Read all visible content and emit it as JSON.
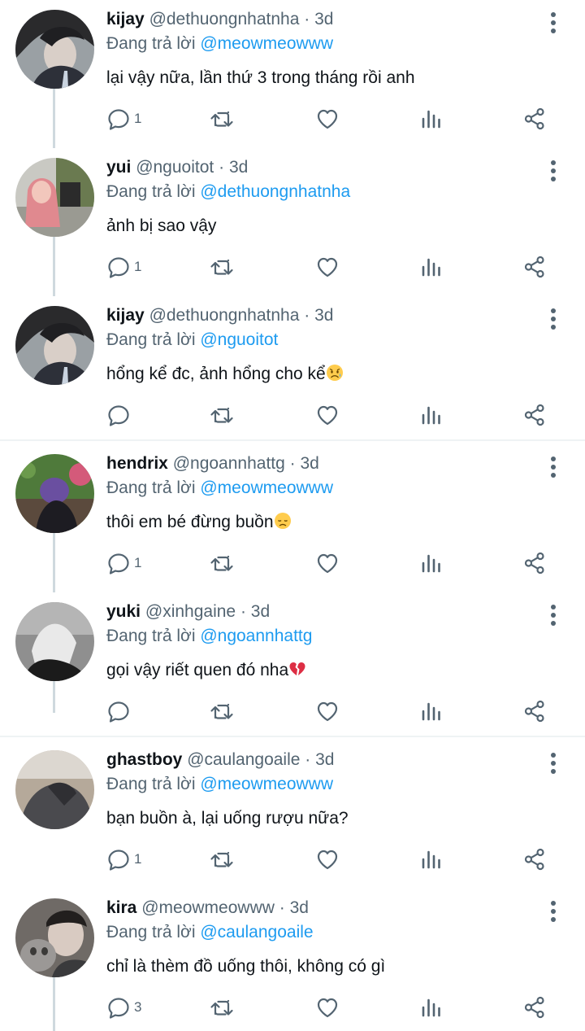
{
  "reply_prefix": "Đang trả lời",
  "tweets": [
    {
      "name": "kijay",
      "handle": "@dethuongnhatnha",
      "time": "3d",
      "reply_to": "@meowmeowww",
      "text": "lại vậy nữa, lần thứ 3 trong tháng rồi anh",
      "reply_count": "1",
      "emoji": ""
    },
    {
      "name": "yui",
      "handle": "@nguoitot",
      "time": "3d",
      "reply_to": "@dethuongnhatnha",
      "text": "ảnh bị sao vậy",
      "reply_count": "1",
      "emoji": ""
    },
    {
      "name": "kijay",
      "handle": "@dethuongnhatnha",
      "time": "3d",
      "reply_to": "@nguoitot",
      "text": "hổng kể đc, ảnh hổng cho kể",
      "reply_count": "",
      "emoji": "worried-face"
    },
    {
      "name": "hendrix",
      "handle": "@ngoannhattg",
      "time": "3d",
      "reply_to": "@meowmeowww",
      "text": "thôi em bé đừng buồn",
      "reply_count": "1",
      "emoji": "disappointed-face"
    },
    {
      "name": "yuki",
      "handle": "@xinhgaine",
      "time": "3d",
      "reply_to": "@ngoannhattg",
      "text": "gọi vậy riết quen đó nha",
      "reply_count": "",
      "emoji": "broken-heart"
    },
    {
      "name": "ghastboy",
      "handle": "@caulangoaile",
      "time": "3d",
      "reply_to": "@meowmeowww",
      "text": "bạn buồn à, lại uống rượu nữa?",
      "reply_count": "1",
      "emoji": ""
    },
    {
      "name": "kira",
      "handle": "@meowmeowww",
      "time": "3d",
      "reply_to": "@caulangoaile",
      "text": "chỉ là thèm đồ uống thôi, không có gì",
      "reply_count": "3",
      "emoji": ""
    }
  ],
  "icons": {
    "reply": "reply-icon",
    "retweet": "retweet-icon",
    "like": "heart-icon",
    "views": "views-icon",
    "share": "share-icon",
    "more": "more-vertical-icon"
  },
  "colors": {
    "link": "#1d9bf0",
    "muted": "#536471",
    "text": "#0f1419"
  }
}
